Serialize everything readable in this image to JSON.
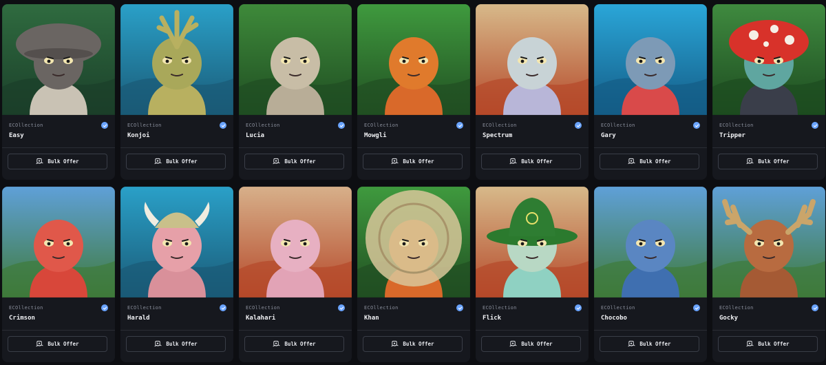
{
  "button_label": "Bulk Offer",
  "cards": [
    {
      "collection": "ECOllection",
      "name": "Easy",
      "art": {
        "bg1": "#2f6b3f",
        "bg2": "#1b3f2a",
        "body": "#c9c2b4",
        "head": "#6a6562",
        "accent": "#f0c040",
        "hat": "mushroom-gray"
      }
    },
    {
      "collection": "ECOllection",
      "name": "Konjoi",
      "art": {
        "bg1": "#2aa0c8",
        "bg2": "#1a5a76",
        "body": "#b8b060",
        "head": "#a9a85a",
        "accent": "#d98a9a",
        "hat": "coral"
      }
    },
    {
      "collection": "ECOllection",
      "name": "Lucia",
      "art": {
        "bg1": "#3e8a3a",
        "bg2": "#1f4d22",
        "body": "#b8ad97",
        "head": "#c8bda6",
        "accent": "#5b4a3a",
        "hat": "none"
      }
    },
    {
      "collection": "ECOllection",
      "name": "Mowgli",
      "art": {
        "bg1": "#3f9a3e",
        "bg2": "#214f22",
        "body": "#d9692a",
        "head": "#e07a2c",
        "accent": "#1b1b1b",
        "hat": "none"
      }
    },
    {
      "collection": "ECOllection",
      "name": "Spectrum",
      "art": {
        "bg1": "#d7b98a",
        "bg2": "#b5492a",
        "body": "#b8b6d8",
        "head": "#c8d3d6",
        "accent": "#e3b03a",
        "hat": "none"
      }
    },
    {
      "collection": "ECOllection",
      "name": "Gary",
      "art": {
        "bg1": "#2aa6d8",
        "bg2": "#145c86",
        "body": "#d94a4a",
        "head": "#7d9ab6",
        "accent": "#f0d050",
        "hat": "none"
      }
    },
    {
      "collection": "ECOllection",
      "name": "Tripper",
      "art": {
        "bg1": "#3f8a3f",
        "bg2": "#1d4b20",
        "body": "#3a3e4a",
        "head": "#5fa6a0",
        "accent": "#d8322a",
        "hat": "mushroom-red"
      }
    },
    {
      "collection": "ECOllection",
      "name": "Crimson",
      "art": {
        "bg1": "#5fa0d8",
        "bg2": "#3f7a3a",
        "body": "#d8473a",
        "head": "#e0584a",
        "accent": "#f0c030",
        "hat": "none"
      }
    },
    {
      "collection": "ECOllection",
      "name": "Harald",
      "art": {
        "bg1": "#2aa0c8",
        "bg2": "#1a5a76",
        "body": "#d9909a",
        "head": "#e6a0a8",
        "accent": "#c9c08a",
        "hat": "viking"
      }
    },
    {
      "collection": "ECOllection",
      "name": "Kalahari",
      "art": {
        "bg1": "#d7b08a",
        "bg2": "#b5492a",
        "body": "#e2a3b6",
        "head": "#e7b0c2",
        "accent": "#e3b03a",
        "hat": "none"
      }
    },
    {
      "collection": "ECOllection",
      "name": "Khan",
      "art": {
        "bg1": "#3f9a3e",
        "bg2": "#214f22",
        "body": "#d9692a",
        "head": "#e07a2c",
        "accent": "#c8b88a",
        "hat": "straw"
      }
    },
    {
      "collection": "ECOllection",
      "name": "Flick",
      "art": {
        "bg1": "#d7b98a",
        "bg2": "#b5492a",
        "body": "#8fd1c2",
        "head": "#b8d8c4",
        "accent": "#2e7d32",
        "hat": "green"
      }
    },
    {
      "collection": "ECOllection",
      "name": "Chocobo",
      "art": {
        "bg1": "#5fa0d8",
        "bg2": "#3f7a3a",
        "body": "#3f6fb0",
        "head": "#5a86c2",
        "accent": "#9b59d0",
        "hat": "none"
      }
    },
    {
      "collection": "ECOllection",
      "name": "Gocky",
      "art": {
        "bg1": "#5fa0d8",
        "bg2": "#3f7a3a",
        "body": "#a55a34",
        "head": "#b86b40",
        "accent": "#c43a3a",
        "hat": "antlers"
      }
    }
  ]
}
